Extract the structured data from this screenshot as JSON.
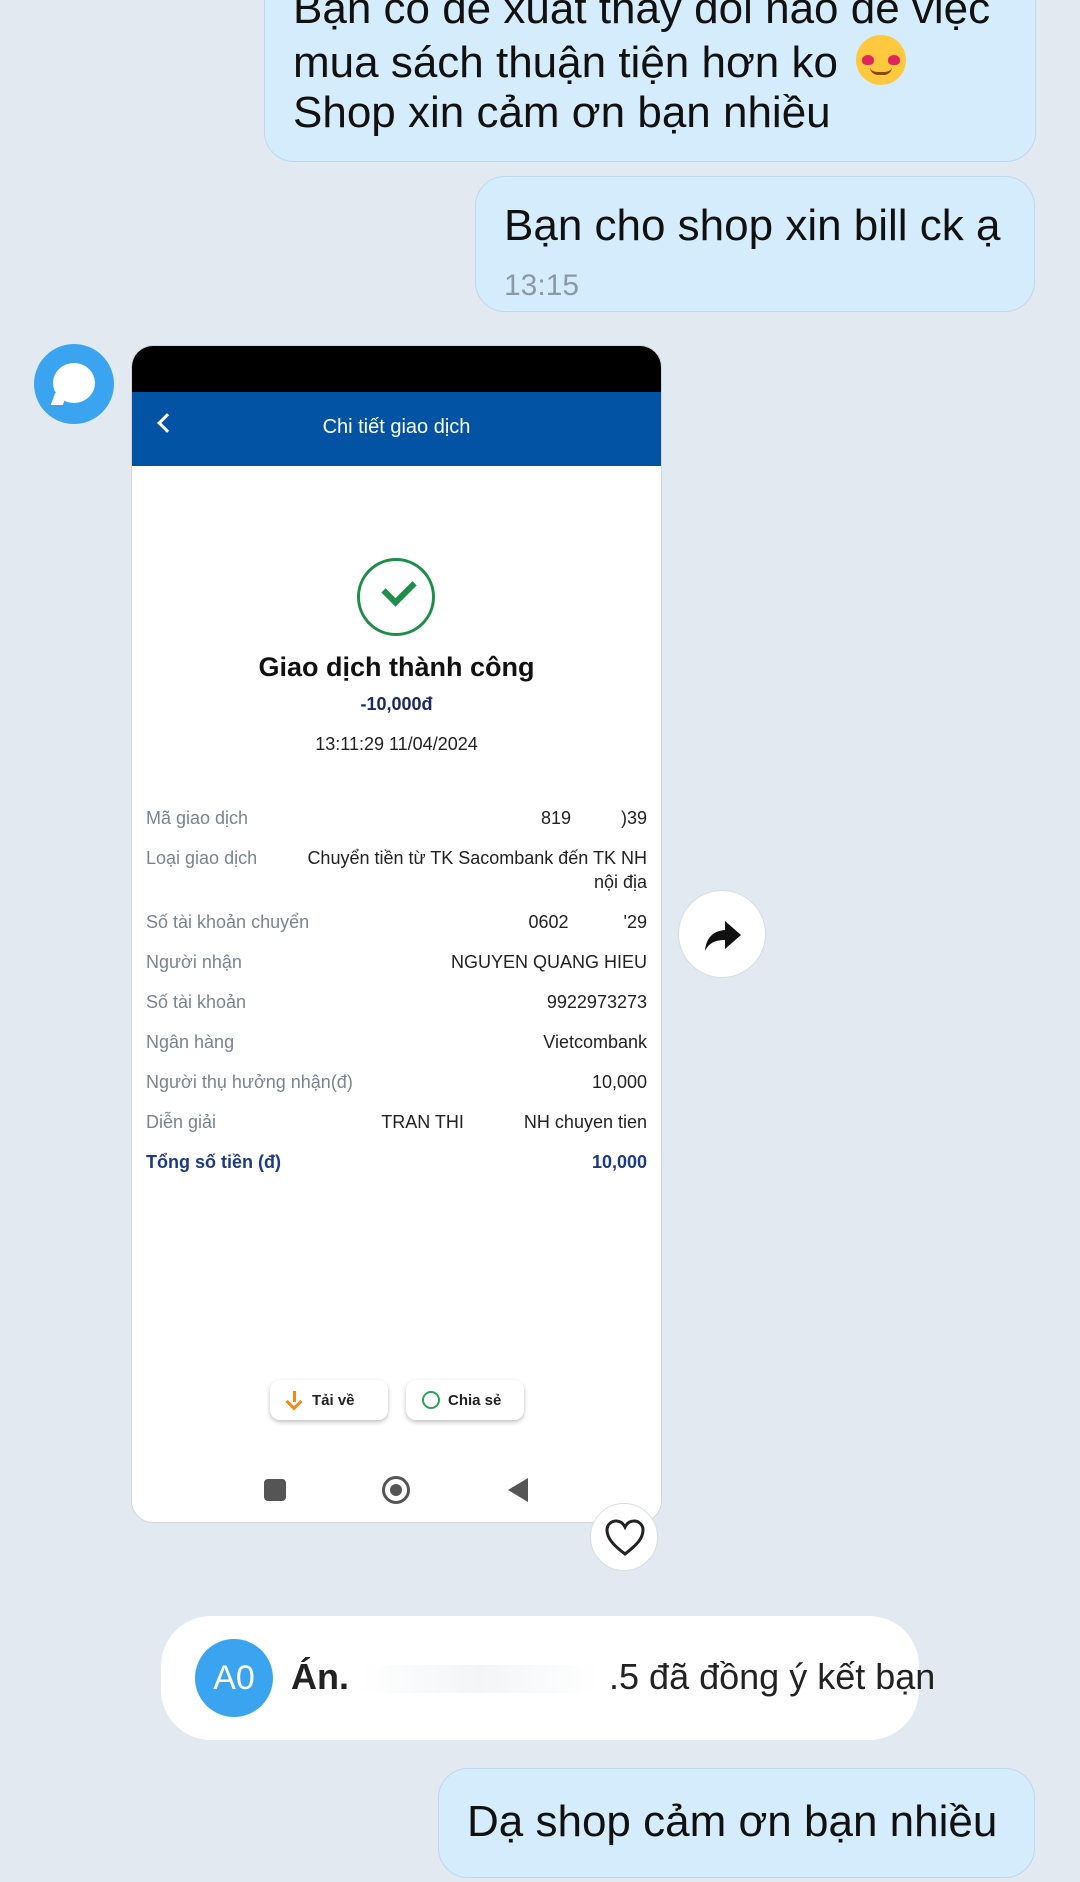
{
  "messages": {
    "msg1": {
      "line1": "Bạn có đề xuất thay đổi nào để việc",
      "line2": "mua sách thuận tiện hơn ko",
      "line3": "Shop xin cảm ơn bạn nhiều",
      "emoji": "smiling-face-with-hearts"
    },
    "msg2": {
      "text": "Bạn cho shop xin bill ck ạ",
      "time": "13:15"
    },
    "msg3": {
      "text": "Dạ shop cảm ơn bạn nhiều"
    }
  },
  "receipt": {
    "header_title": "Chi tiết giao dịch",
    "status": "Giao dịch thành công",
    "amount": "-10,000đ",
    "datetime": "13:11:29 11/04/2024",
    "rows": [
      {
        "label": "Mã giao dịch",
        "value": "819 ​ ​ ​ ​ ​ ​ ​ ​ ​ )39"
      },
      {
        "label": "Loại giao dịch",
        "value": "Chuyển tiền từ TK Sacombank đến TK NH",
        "value2": "nội địa"
      },
      {
        "label": "Số tài khoản chuyển",
        "value": "0602 ​ ​ ​ ​ ​ ​ ​ ​ ​ ​ '29"
      },
      {
        "label": "Người nhận",
        "value": "NGUYEN QUANG HIEU"
      },
      {
        "label": "Số tài khoản",
        "value": "9922973273"
      },
      {
        "label": "Ngân hàng",
        "value": "Vietcombank"
      },
      {
        "label": "Người thụ hưởng nhận(đ)",
        "value": "10,000"
      },
      {
        "label": "Diễn giải",
        "value": "TRAN THI ​ ​ ​ ​ ​ ​ ​ ​ ​ ​ ​ NH chuyen tien"
      },
      {
        "label": "Tổng số tiền (đ)",
        "value": "10,000"
      }
    ],
    "download_label": "Tải về",
    "share_label": "Chia sẻ"
  },
  "system_notice": {
    "avatar_initials": "A0",
    "name": "Án.",
    "suffix": ".5 đã đồng ý kết bạn"
  },
  "colors": {
    "bubble": "#d5ecfc",
    "background": "#e2e9f1",
    "bank_header": "#0353a4",
    "success": "#1e8e4a",
    "avatar": "#3aa4f0"
  }
}
